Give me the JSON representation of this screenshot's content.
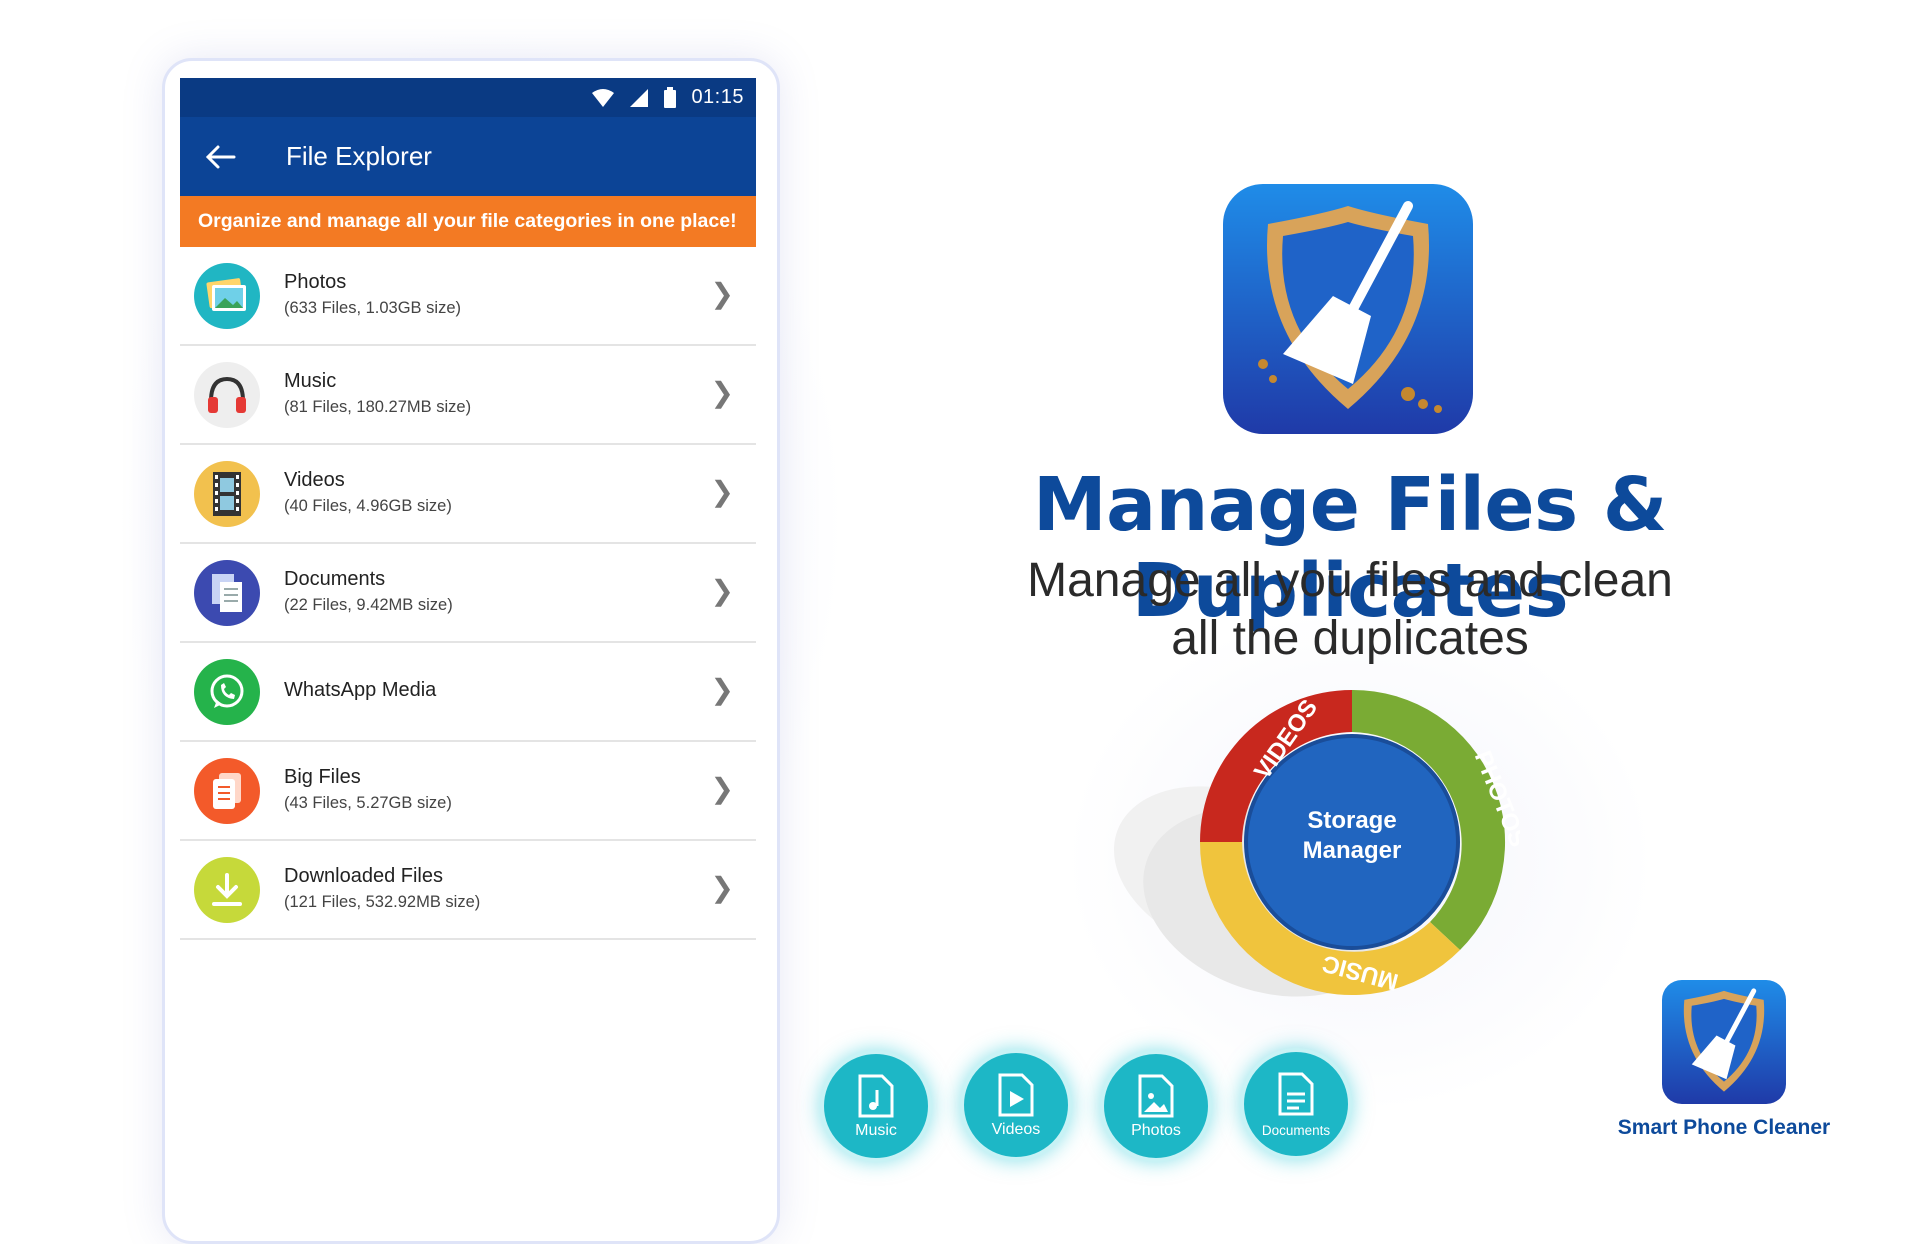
{
  "status_bar": {
    "time": "01:15"
  },
  "app_bar": {
    "title": "File Explorer"
  },
  "banner": {
    "text": "Organize and manage all your file categories in one place!"
  },
  "file_categories": [
    {
      "title": "Photos",
      "subtitle": "(633 Files, 1.03GB size)",
      "icon": "photos-icon",
      "color": "#20b6c3"
    },
    {
      "title": "Music",
      "subtitle": "(81 Files, 180.27MB size)",
      "icon": "headphones-icon",
      "color": "#eeeeee"
    },
    {
      "title": "Videos",
      "subtitle": "(40 Files, 4.96GB size)",
      "icon": "film-icon",
      "color": "#f2c14e"
    },
    {
      "title": "Documents",
      "subtitle": "(22 Files, 9.42MB size)",
      "icon": "documents-icon",
      "color": "#3c4ab0"
    },
    {
      "title": "WhatsApp Media",
      "subtitle": "",
      "icon": "whatsapp-icon",
      "color": "#25b34b"
    },
    {
      "title": "Big Files",
      "subtitle": "(43 Files, 5.27GB size)",
      "icon": "big-files-icon",
      "color": "#f35a2a"
    },
    {
      "title": "Downloaded Files",
      "subtitle": "(121 Files, 532.92MB size)",
      "icon": "download-icon",
      "color": "#c6d93a"
    }
  ],
  "promo": {
    "headline": "Manage Files & Duplicates",
    "subline_1": "Manage all you files and clean",
    "subline_2": "all the duplicates"
  },
  "storage_ring": {
    "center_line_1": "Storage",
    "center_line_2": "Manager",
    "segments": [
      "VIDEOS",
      "PHOTOS",
      "MUSIC"
    ],
    "colors": {
      "videos": "#c8281e",
      "photos": "#7aab34",
      "music": "#f0c43d",
      "center": "#2165bf"
    }
  },
  "category_buttons": [
    "Music",
    "Videos",
    "Photos",
    "Documents"
  ],
  "brand": {
    "name": "Smart Phone Cleaner"
  },
  "colors": {
    "primary": "#0c4496",
    "accent": "#f37a23",
    "headline": "#0d4a9b"
  }
}
